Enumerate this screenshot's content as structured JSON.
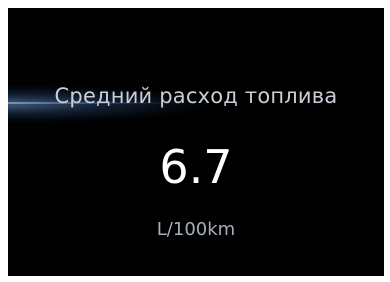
{
  "display": {
    "title": "Средний расход топлива",
    "value": "6.7",
    "unit": "L/100km"
  },
  "colors": {
    "background": "#000000",
    "title_text": "#c9ced6",
    "value_text": "#ffffff",
    "unit_text": "#a6adb7",
    "accent_glow": "#78aae6"
  }
}
